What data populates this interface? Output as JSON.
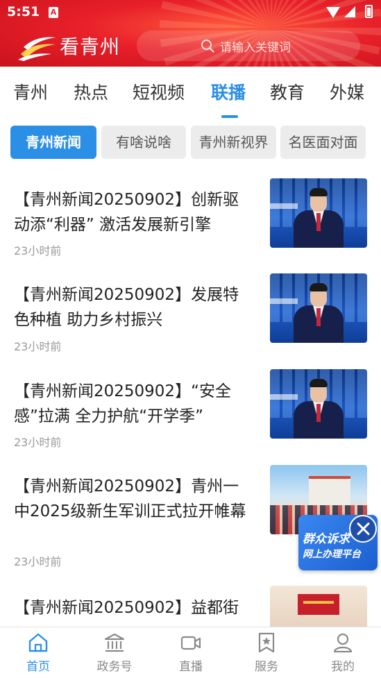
{
  "status_bar": {
    "time": "5:51",
    "notification_glyph": "A"
  },
  "header": {
    "logo_text": "看青州",
    "search_placeholder": "请输入关键词",
    "background": "#e8202a"
  },
  "channel_tabs": [
    {
      "label": "青州"
    },
    {
      "label": "热点"
    },
    {
      "label": "短视频"
    },
    {
      "label": "联播",
      "active": true
    },
    {
      "label": "教育"
    },
    {
      "label": "外媒"
    }
  ],
  "sub_tabs": [
    {
      "label": "青州新闻",
      "active": true
    },
    {
      "label": "有啥说啥"
    },
    {
      "label": "青州新视界"
    },
    {
      "label": "名医面对面"
    }
  ],
  "news": [
    {
      "title": "【青州新闻20250902】创新驱动添“利器” 激活发展新引擎",
      "time": "23小时前"
    },
    {
      "title": "【青州新闻20250902】发展特色种植 助力乡村振兴",
      "time": "23小时前"
    },
    {
      "title": "【青州新闻20250902】“安全感”拉满 全力护航“开学季”",
      "time": "23小时前"
    },
    {
      "title": "【青州新闻20250902】青州一中2025级新生军训正式拉开帷幕",
      "time": "23小时前"
    },
    {
      "title": "【青州新闻20250902】益都街",
      "time": ""
    }
  ],
  "float_ad": {
    "line1": "群众诉求",
    "line2": "网上办理平台"
  },
  "bottom_nav": [
    {
      "label": "首页",
      "icon": "home-icon",
      "active": true
    },
    {
      "label": "政务号",
      "icon": "government-building-icon"
    },
    {
      "label": "直播",
      "icon": "video-camera-icon"
    },
    {
      "label": "服务",
      "icon": "star-bookmark-icon"
    },
    {
      "label": "我的",
      "icon": "user-icon"
    }
  ],
  "colors": {
    "accent": "#2b8fe6",
    "brand_red": "#e8202a",
    "muted_text": "#9a9a9a"
  }
}
